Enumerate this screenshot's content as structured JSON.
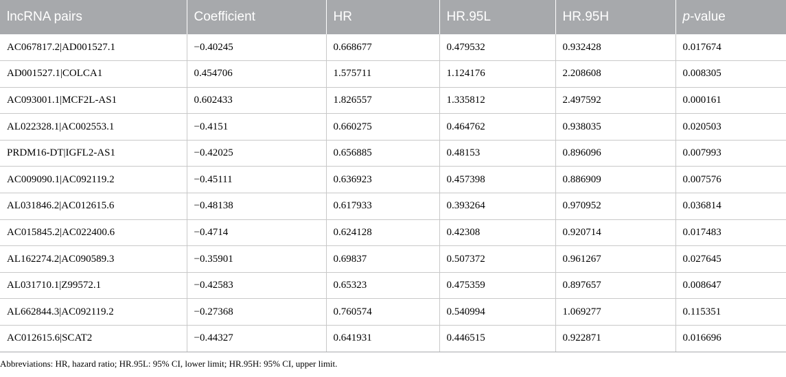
{
  "table": {
    "headers": {
      "pairs": "lncRNA pairs",
      "coefficient": "Coefficient",
      "hr": "HR",
      "hr95l": "HR.95L",
      "hr95h": "HR.95H",
      "pvalue_italic": "p",
      "pvalue_rest": "-value"
    },
    "rows": [
      {
        "pair": "AC067817.2|AD001527.1",
        "coef": "−0.40245",
        "hr": "0.668677",
        "hr95l": "0.479532",
        "hr95h": "0.932428",
        "p": "0.017674"
      },
      {
        "pair": "AD001527.1|COLCA1",
        "coef": "0.454706",
        "hr": "1.575711",
        "hr95l": "1.124176",
        "hr95h": "2.208608",
        "p": "0.008305"
      },
      {
        "pair": "AC093001.1|MCF2L-AS1",
        "coef": "0.602433",
        "hr": "1.826557",
        "hr95l": "1.335812",
        "hr95h": "2.497592",
        "p": "0.000161"
      },
      {
        "pair": "AL022328.1|AC002553.1",
        "coef": "−0.4151",
        "hr": "0.660275",
        "hr95l": "0.464762",
        "hr95h": "0.938035",
        "p": "0.020503"
      },
      {
        "pair": "PRDM16-DT|IGFL2-AS1",
        "coef": "−0.42025",
        "hr": "0.656885",
        "hr95l": "0.48153",
        "hr95h": "0.896096",
        "p": "0.007993"
      },
      {
        "pair": "AC009090.1|AC092119.2",
        "coef": "−0.45111",
        "hr": "0.636923",
        "hr95l": "0.457398",
        "hr95h": "0.886909",
        "p": "0.007576"
      },
      {
        "pair": "AL031846.2|AC012615.6",
        "coef": "−0.48138",
        "hr": "0.617933",
        "hr95l": "0.393264",
        "hr95h": "0.970952",
        "p": "0.036814"
      },
      {
        "pair": "AC015845.2|AC022400.6",
        "coef": "−0.4714",
        "hr": "0.624128",
        "hr95l": "0.42308",
        "hr95h": "0.920714",
        "p": "0.017483"
      },
      {
        "pair": "AL162274.2|AC090589.3",
        "coef": "−0.35901",
        "hr": "0.69837",
        "hr95l": "0.507372",
        "hr95h": "0.961267",
        "p": "0.027645"
      },
      {
        "pair": "AL031710.1|Z99572.1",
        "coef": "−0.42583",
        "hr": "0.65323",
        "hr95l": "0.475359",
        "hr95h": "0.897657",
        "p": "0.008647"
      },
      {
        "pair": "AL662844.3|AC092119.2",
        "coef": "−0.27368",
        "hr": "0.760574",
        "hr95l": "0.540994",
        "hr95h": "1.069277",
        "p": "0.115351"
      },
      {
        "pair": "AC012615.6|SCAT2",
        "coef": "−0.44327",
        "hr": "0.641931",
        "hr95l": "0.446515",
        "hr95h": "0.922871",
        "p": "0.016696"
      }
    ]
  },
  "footnote": "Abbreviations: HR, hazard ratio; HR.95L: 95% CI, lower limit; HR.95H: 95% CI, upper limit.",
  "colors": {
    "header_bg": "#a7a9ac",
    "header_text": "#ffffff",
    "row_border": "#c8c8c8"
  }
}
